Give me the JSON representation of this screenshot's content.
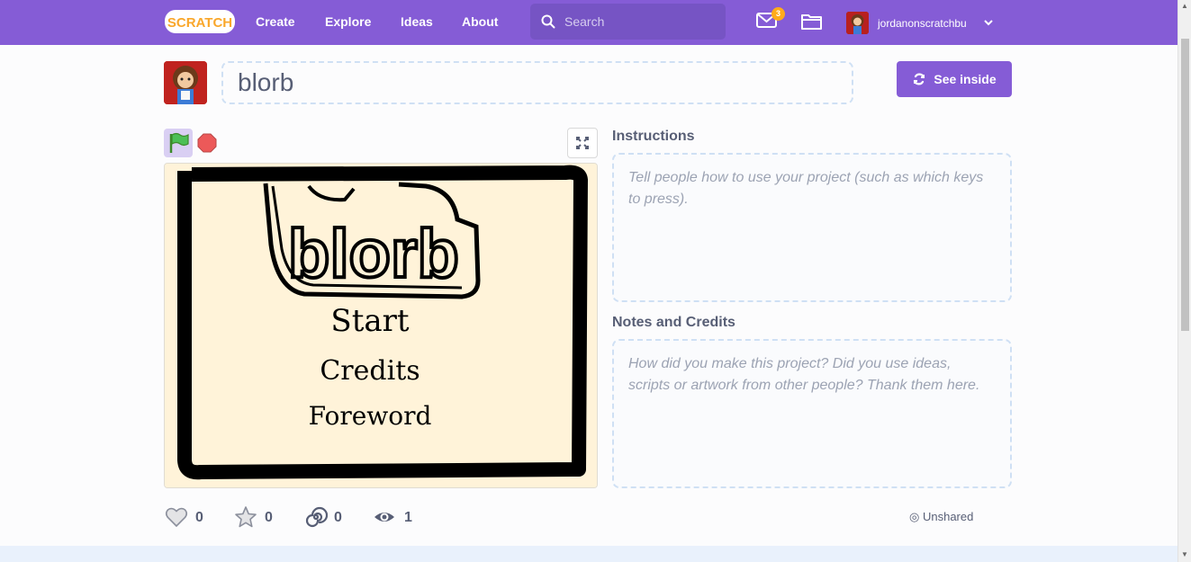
{
  "nav": {
    "logo_text": "SCRATCH",
    "links": [
      "Create",
      "Explore",
      "Ideas",
      "About"
    ],
    "search_placeholder": "Search",
    "message_count": "3",
    "username": "jordanonscratchbu",
    "brand_color": "#855cd6"
  },
  "project": {
    "title": "blorb",
    "see_inside_label": "See inside",
    "instructions_heading": "Instructions",
    "instructions_placeholder": "Tell people how to use your project (such as which keys to press).",
    "notes_heading": "Notes and Credits",
    "notes_placeholder": "How did you make this project? Did you use ideas, scripts or artwork from other people? Thank them here.",
    "stage_text": {
      "title": "blorb",
      "menu": [
        "Start",
        "Credits",
        "Foreword"
      ]
    }
  },
  "stats": {
    "loves": "0",
    "favorites": "0",
    "remixes": "0",
    "views": "1",
    "share_status": "Unshared"
  },
  "icons": [
    "search-icon",
    "messages-icon",
    "my-stuff-folder-icon",
    "chevron-down-icon",
    "green-flag-icon",
    "stop-icon",
    "fullscreen-icon",
    "see-inside-icon",
    "heart-icon",
    "star-icon",
    "remix-icon",
    "eye-icon"
  ]
}
